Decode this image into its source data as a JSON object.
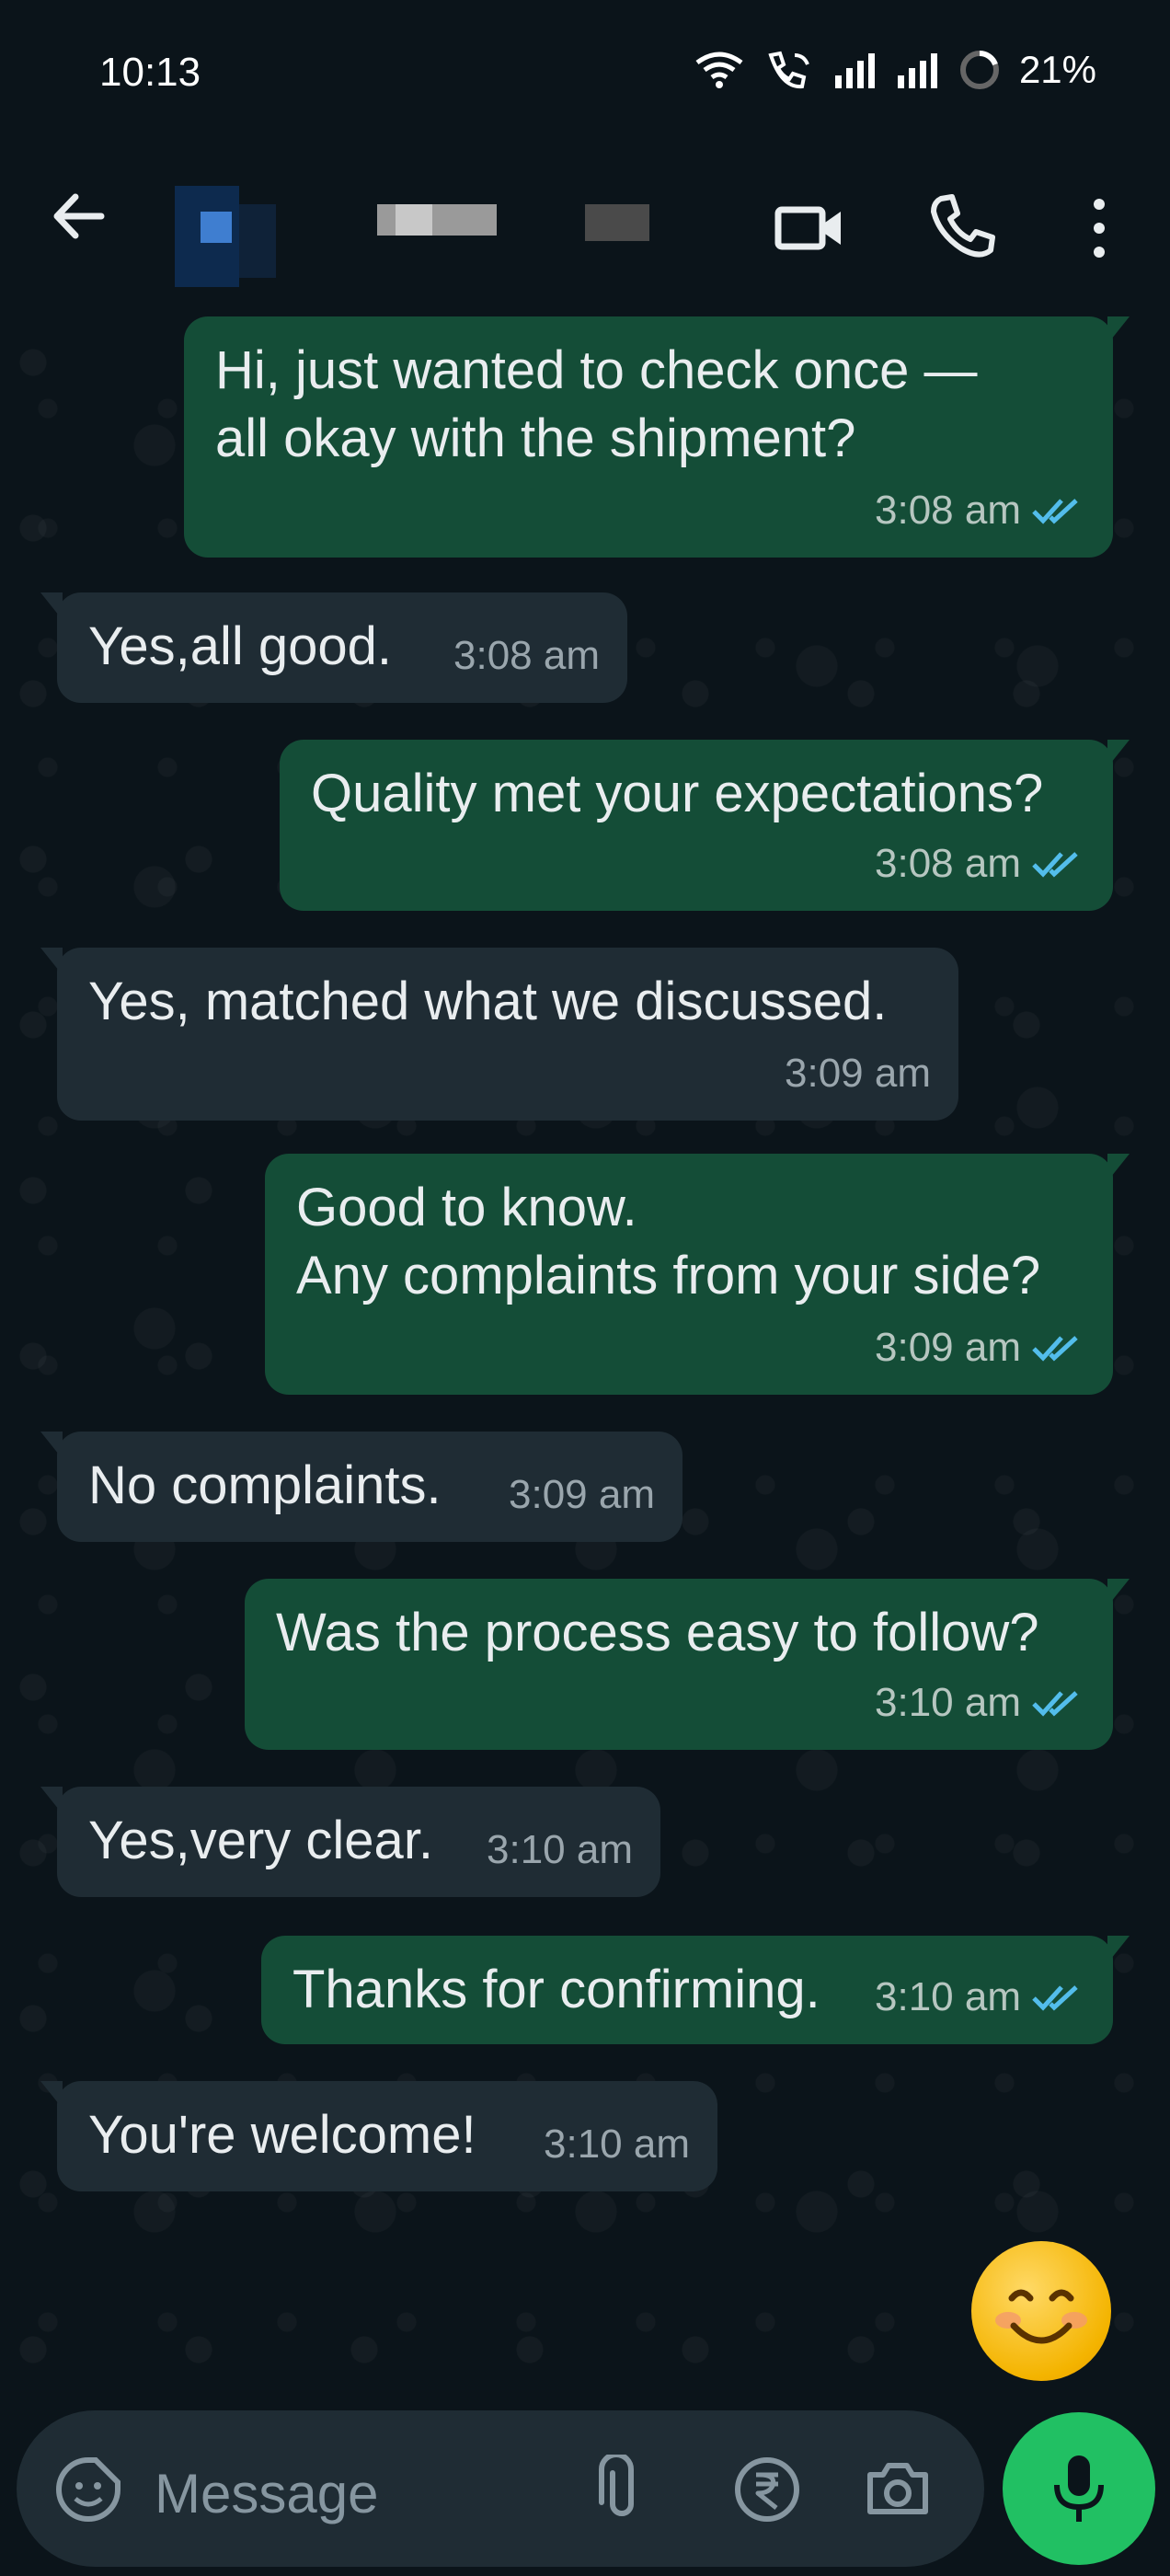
{
  "status_bar": {
    "time": "10:13",
    "battery": "21%",
    "icons": [
      "wifi-icon",
      "wifi-call-icon",
      "signal-icon",
      "signal-icon",
      "battery-icon"
    ]
  },
  "header": {
    "contact_name": "",
    "icons": [
      "back-arrow-icon",
      "video-call-icon",
      "phone-icon",
      "more-options-icon"
    ]
  },
  "messages": [
    {
      "direction": "outgoing",
      "text": "Hi, just wanted to check once —\nall okay with the shipment?",
      "time": "3:08 am",
      "status": "read"
    },
    {
      "direction": "incoming",
      "text": "Yes,all good.",
      "time": "3:08 am"
    },
    {
      "direction": "outgoing",
      "text": "Quality met your expectations?",
      "time": "3:08 am",
      "status": "read"
    },
    {
      "direction": "incoming",
      "text": "Yes, matched what we discussed.",
      "time": "3:09 am"
    },
    {
      "direction": "outgoing",
      "text": "Good to know.\nAny complaints from your side?",
      "time": "3:09 am",
      "status": "read"
    },
    {
      "direction": "incoming",
      "text": "No complaints.",
      "time": "3:09 am"
    },
    {
      "direction": "outgoing",
      "text": "Was the process easy to follow?",
      "time": "3:10 am",
      "status": "read"
    },
    {
      "direction": "incoming",
      "text": "Yes,very clear.",
      "time": "3:10 am"
    },
    {
      "direction": "outgoing",
      "text": "Thanks for confirming.",
      "time": "3:10 am",
      "status": "read"
    },
    {
      "direction": "incoming",
      "text": "You're welcome!",
      "time": "3:10 am"
    }
  ],
  "emoji": "😊",
  "composer": {
    "placeholder": "Message",
    "icons": [
      "sticker-icon",
      "attach-icon",
      "rupee-payment-icon",
      "camera-icon",
      "mic-icon"
    ]
  },
  "colors": {
    "outgoing_bubble": "#144d37",
    "incoming_bubble": "#1f2c34",
    "read_tick": "#53bdeb",
    "mic_button": "#21c063"
  }
}
